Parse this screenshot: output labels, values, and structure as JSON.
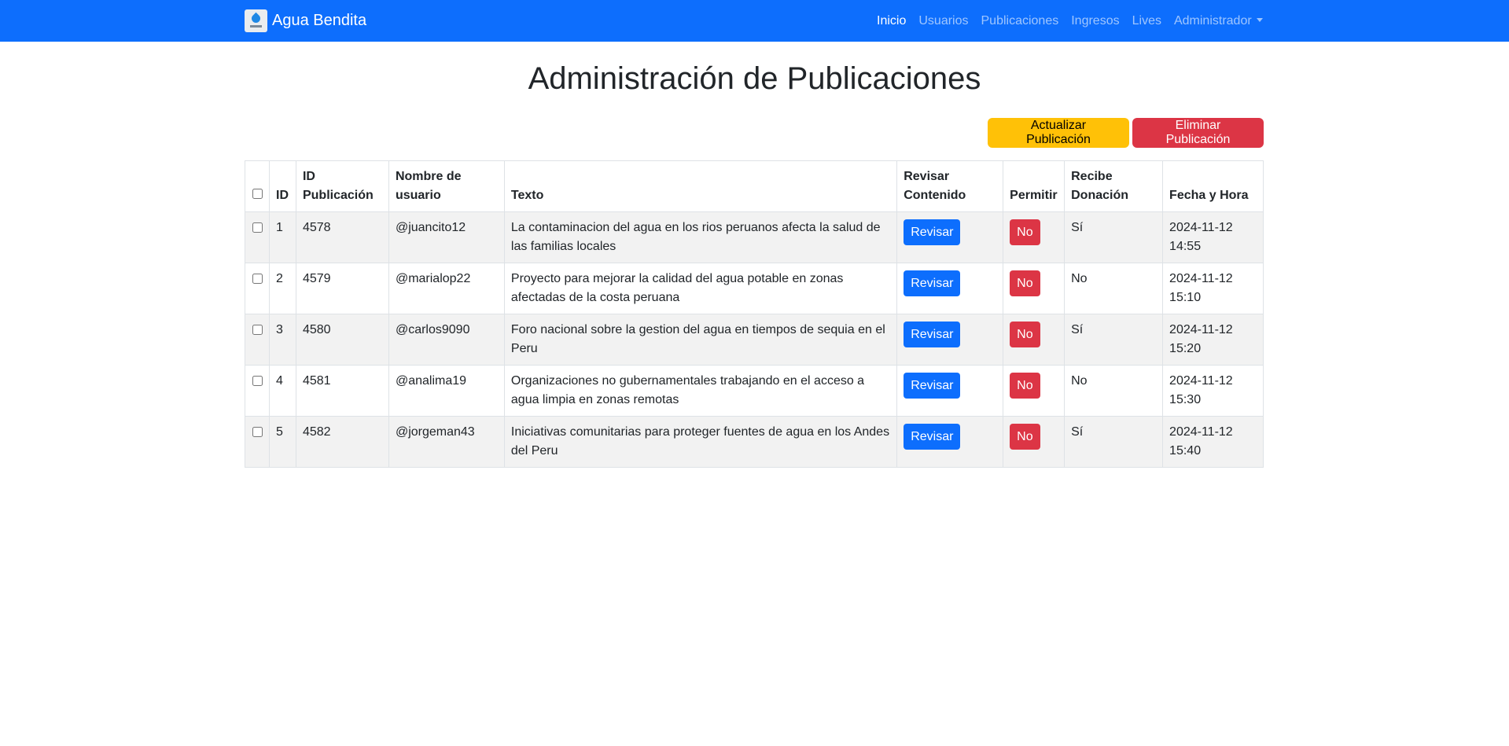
{
  "navbar": {
    "brand": "Agua Bendita",
    "items": [
      {
        "label": "Inicio",
        "active": true
      },
      {
        "label": "Usuarios"
      },
      {
        "label": "Publicaciones"
      },
      {
        "label": "Ingresos"
      },
      {
        "label": "Lives"
      },
      {
        "label": "Administrador",
        "dropdown": true
      }
    ]
  },
  "page": {
    "title": "Administración de Publicaciones",
    "update_button": "Actualizar Publicación",
    "delete_button": "Eliminar Publicación"
  },
  "table": {
    "headers": {
      "id": "ID",
      "pub_id": "ID Publicación",
      "user": "Nombre de usuario",
      "text": "Texto",
      "review": "Revisar Contenido",
      "allow": "Permitir",
      "donation": "Recibe Donación",
      "datetime": "Fecha y Hora"
    },
    "rows": [
      {
        "id": "1",
        "pub_id": "4578",
        "user": "@juancito12",
        "text": "La contaminacion del agua en los rios peruanos afecta la salud de las familias locales",
        "review": "Revisar",
        "allow": "No",
        "donation": "Sí",
        "datetime": "2024-11-12 14:55"
      },
      {
        "id": "2",
        "pub_id": "4579",
        "user": "@marialop22",
        "text": "Proyecto para mejorar la calidad del agua potable en zonas afectadas de la costa peruana",
        "review": "Revisar",
        "allow": "No",
        "donation": "No",
        "datetime": "2024-11-12 15:10"
      },
      {
        "id": "3",
        "pub_id": "4580",
        "user": "@carlos9090",
        "text": "Foro nacional sobre la gestion del agua en tiempos de sequia en el Peru",
        "review": "Revisar",
        "allow": "No",
        "donation": "Sí",
        "datetime": "2024-11-12 15:20"
      },
      {
        "id": "4",
        "pub_id": "4581",
        "user": "@analima19",
        "text": "Organizaciones no gubernamentales trabajando en el acceso a agua limpia en zonas remotas",
        "review": "Revisar",
        "allow": "No",
        "donation": "No",
        "datetime": "2024-11-12 15:30"
      },
      {
        "id": "5",
        "pub_id": "4582",
        "user": "@jorgeman43",
        "text": "Iniciativas comunitarias para proteger fuentes de agua en los Andes del Peru",
        "review": "Revisar",
        "allow": "No",
        "donation": "Sí",
        "datetime": "2024-11-12 15:40"
      }
    ]
  },
  "colors": {
    "navbar": "#0d6efd",
    "warning": "#ffc107",
    "danger": "#dc3545",
    "primary": "#0d6efd",
    "stripe": "#f2f2f2"
  }
}
